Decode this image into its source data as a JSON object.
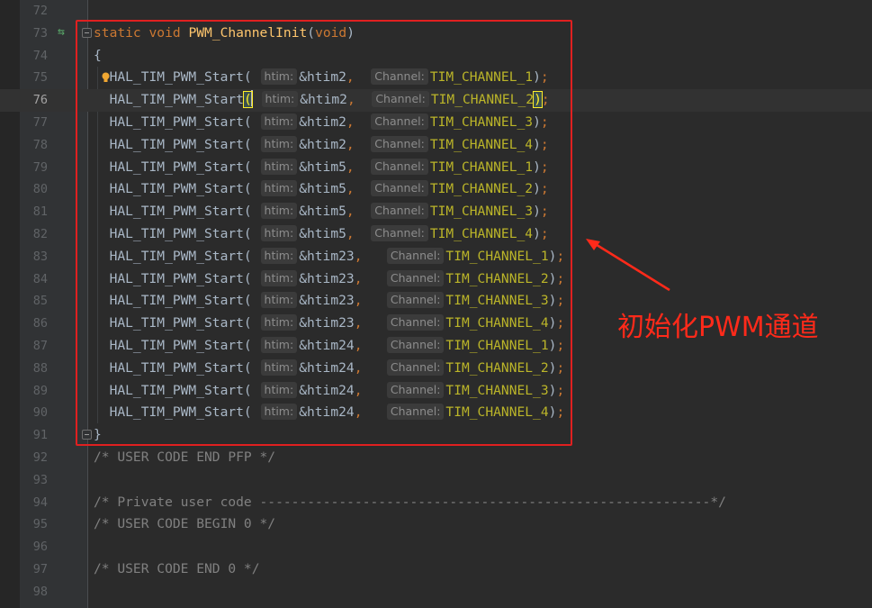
{
  "colors": {
    "background": "#2b2b2b",
    "keyword": "#cc7832",
    "function": "#ffc66d",
    "constant": "#bbb529",
    "comment": "#808080",
    "annotation_red": "#e02020"
  },
  "editor": {
    "lines": [
      {
        "num": "72",
        "text": ""
      },
      {
        "num": "73",
        "text": "static void PWM_ChannelInit(void)"
      },
      {
        "num": "74",
        "text": "{"
      },
      {
        "num": "75",
        "func": "HAL_TIM_PWM_Start",
        "hint1": "htim:",
        "arg1": "&htim2",
        "hint2": "Channel:",
        "arg2": "TIM_CHANNEL_1"
      },
      {
        "num": "76",
        "func": "HAL_TIM_PWM_Start",
        "hint1": "htim:",
        "arg1": "&htim2",
        "hint2": "Channel:",
        "arg2": "TIM_CHANNEL_2"
      },
      {
        "num": "77",
        "func": "HAL_TIM_PWM_Start",
        "hint1": "htim:",
        "arg1": "&htim2",
        "hint2": "Channel:",
        "arg2": "TIM_CHANNEL_3"
      },
      {
        "num": "78",
        "func": "HAL_TIM_PWM_Start",
        "hint1": "htim:",
        "arg1": "&htim2",
        "hint2": "Channel:",
        "arg2": "TIM_CHANNEL_4"
      },
      {
        "num": "79",
        "func": "HAL_TIM_PWM_Start",
        "hint1": "htim:",
        "arg1": "&htim5",
        "hint2": "Channel:",
        "arg2": "TIM_CHANNEL_1"
      },
      {
        "num": "80",
        "func": "HAL_TIM_PWM_Start",
        "hint1": "htim:",
        "arg1": "&htim5",
        "hint2": "Channel:",
        "arg2": "TIM_CHANNEL_2"
      },
      {
        "num": "81",
        "func": "HAL_TIM_PWM_Start",
        "hint1": "htim:",
        "arg1": "&htim5",
        "hint2": "Channel:",
        "arg2": "TIM_CHANNEL_3"
      },
      {
        "num": "82",
        "func": "HAL_TIM_PWM_Start",
        "hint1": "htim:",
        "arg1": "&htim5",
        "hint2": "Channel:",
        "arg2": "TIM_CHANNEL_4"
      },
      {
        "num": "83",
        "func": "HAL_TIM_PWM_Start",
        "hint1": "htim:",
        "arg1": "&htim23",
        "hint2": "Channel:",
        "arg2": "TIM_CHANNEL_1"
      },
      {
        "num": "84",
        "func": "HAL_TIM_PWM_Start",
        "hint1": "htim:",
        "arg1": "&htim23",
        "hint2": "Channel:",
        "arg2": "TIM_CHANNEL_2"
      },
      {
        "num": "85",
        "func": "HAL_TIM_PWM_Start",
        "hint1": "htim:",
        "arg1": "&htim23",
        "hint2": "Channel:",
        "arg2": "TIM_CHANNEL_3"
      },
      {
        "num": "86",
        "func": "HAL_TIM_PWM_Start",
        "hint1": "htim:",
        "arg1": "&htim23",
        "hint2": "Channel:",
        "arg2": "TIM_CHANNEL_4"
      },
      {
        "num": "87",
        "func": "HAL_TIM_PWM_Start",
        "hint1": "htim:",
        "arg1": "&htim24",
        "hint2": "Channel:",
        "arg2": "TIM_CHANNEL_1"
      },
      {
        "num": "88",
        "func": "HAL_TIM_PWM_Start",
        "hint1": "htim:",
        "arg1": "&htim24",
        "hint2": "Channel:",
        "arg2": "TIM_CHANNEL_2"
      },
      {
        "num": "89",
        "func": "HAL_TIM_PWM_Start",
        "hint1": "htim:",
        "arg1": "&htim24",
        "hint2": "Channel:",
        "arg2": "TIM_CHANNEL_3"
      },
      {
        "num": "90",
        "func": "HAL_TIM_PWM_Start",
        "hint1": "htim:",
        "arg1": "&htim24",
        "hint2": "Channel:",
        "arg2": "TIM_CHANNEL_4"
      },
      {
        "num": "91",
        "text": "}"
      },
      {
        "num": "92",
        "text": "/* USER CODE END PFP */"
      },
      {
        "num": "93",
        "text": ""
      },
      {
        "num": "94",
        "text": "/* Private user code ---------------------------------------------------------*/"
      },
      {
        "num": "95",
        "text": "/* USER CODE BEGIN 0 */"
      },
      {
        "num": "96",
        "text": ""
      },
      {
        "num": "97",
        "text": "/* USER CODE END 0 */"
      },
      {
        "num": "98",
        "text": ""
      }
    ],
    "current_line": "76"
  },
  "signature": {
    "kw_static": "static",
    "kw_void": "void",
    "name": "PWM_ChannelInit",
    "param_void": "void"
  },
  "annotation": {
    "label": "初始化PWM通道"
  },
  "icons": {
    "gutter_marker": "implementation-arrows-icon",
    "fold": "fold-icon",
    "intention": "lightbulb-icon"
  }
}
